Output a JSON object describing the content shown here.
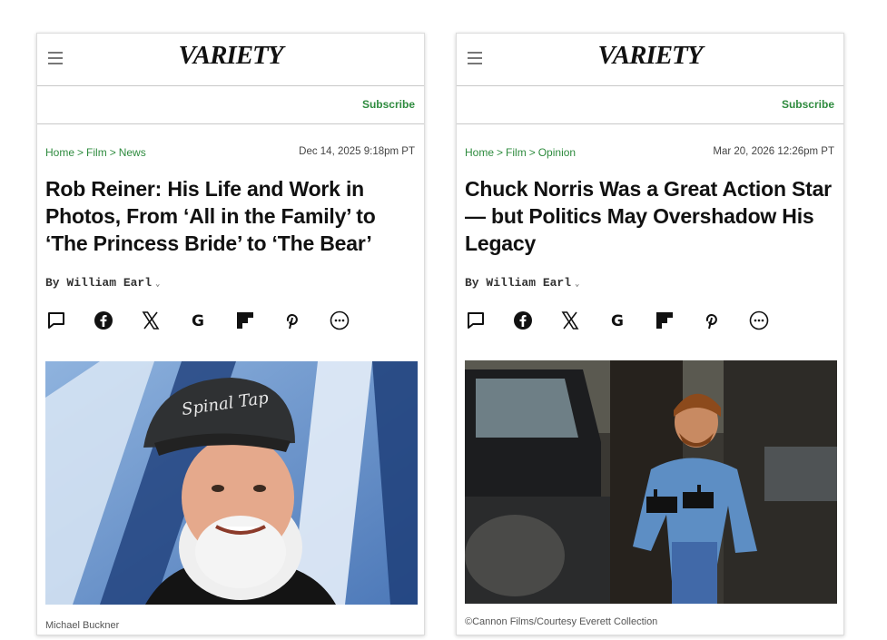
{
  "articles": [
    {
      "logo": "VARIETY",
      "subscribe_label": "Subscribe",
      "breadcrumb": [
        "Home",
        "Film",
        "News"
      ],
      "breadcrumb_separator": ">",
      "timestamp": "Dec 14, 2025 9:18pm PT",
      "headline": "Rob Reiner: His Life and Work in Photos, From ‘All in the Family’ to ‘The Princess Bride’ to ‘The Bear’",
      "byline_prefix": "By",
      "author": "William Earl",
      "photo_credit": "Michael Buckner",
      "photo_cap_text": "Spinal Tap"
    },
    {
      "logo": "VARIETY",
      "subscribe_label": "Subscribe",
      "breadcrumb": [
        "Home",
        "Film",
        "Opinion"
      ],
      "breadcrumb_separator": ">",
      "timestamp": "Mar 20, 2026 12:26pm PT",
      "headline": "Chuck Norris Was a Great Action Star — but Politics May Overshadow His Legacy",
      "byline_prefix": "By",
      "author": "William Earl",
      "photo_credit": "©Cannon Films/Courtesy Everett Collection"
    }
  ],
  "share_icons": [
    "comment-icon",
    "facebook-icon",
    "x-icon",
    "google-icon",
    "flipboard-icon",
    "pinterest-icon",
    "more-icon"
  ],
  "colors": {
    "accent_green": "#2e8b3e",
    "text": "#111111",
    "border": "#c8c8c8"
  }
}
